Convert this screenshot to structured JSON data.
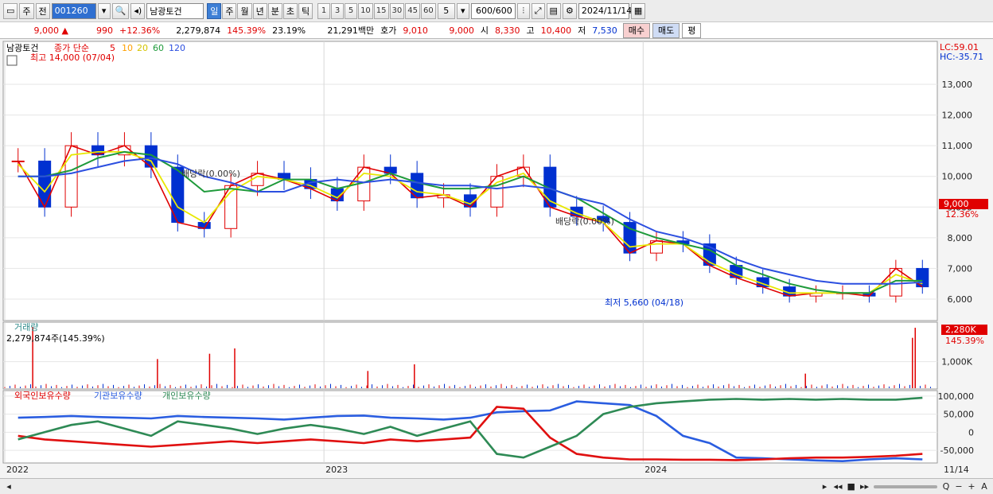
{
  "toolbar": {
    "period_label": "주",
    "nav_label": "전",
    "code": "001260",
    "name": "남광토건",
    "tabs": [
      "일",
      "주",
      "월",
      "년",
      "분",
      "초",
      "틱"
    ],
    "active_tab": "일",
    "intervals": [
      "1",
      "3",
      "5",
      "10",
      "15",
      "30",
      "45",
      "60"
    ],
    "interval_select": "5",
    "range_value": "600",
    "range_total": "/600",
    "date": "2024/11/14"
  },
  "quote": {
    "price": "9,000",
    "price_arrow": "▲",
    "change": "990",
    "change_pct": "+12.36%",
    "volume": "2,279,874",
    "vol_ratio": "145.39%",
    "turnover": "23.19%",
    "amount": "21,291백만",
    "bid_label": "호가",
    "bid": "9,010",
    "ask": "9,000",
    "open_label": "시",
    "open": "8,330",
    "high_label": "고",
    "high": "10,400",
    "low_label": "저",
    "low": "7,530",
    "buy_label": "매수",
    "sell_label": "매도",
    "eval_label": "평"
  },
  "colors": {
    "up": "#e00000",
    "down": "#0030d0",
    "ma5": "#e00000",
    "ma10": "#ffa000",
    "ma20": "#e8e800",
    "ma60": "#1e9a3a",
    "ma120": "#2c4fe0",
    "foreign": "#2a5de0",
    "institution": "#e01010",
    "individual": "#2e8a55"
  },
  "chart_data": [
    {
      "type": "candlestick",
      "legend": {
        "name": "남광토건",
        "label": "종가 단순",
        "periods": [
          "5",
          "10",
          "20",
          "60",
          "120"
        ]
      },
      "x": [
        "2022-01",
        "2022-02",
        "2022-03",
        "2022-04",
        "2022-05",
        "2022-06",
        "2022-07",
        "2022-08",
        "2022-09",
        "2022-10",
        "2022-11",
        "2022-12",
        "2023-01",
        "2023-02",
        "2023-03",
        "2023-04",
        "2023-05",
        "2023-06",
        "2023-07",
        "2023-08",
        "2023-09",
        "2023-10",
        "2023-11",
        "2023-12",
        "2024-01",
        "2024-02",
        "2024-03",
        "2024-04",
        "2024-05",
        "2024-06",
        "2024-07",
        "2024-08",
        "2024-09",
        "2024-10",
        "2024-11"
      ],
      "x_ticks": [
        "2022",
        "2023",
        "2024"
      ],
      "close": [
        10500,
        9000,
        11000,
        10700,
        11000,
        10300,
        8500,
        8300,
        9700,
        10100,
        9900,
        9600,
        9200,
        10300,
        10100,
        9300,
        9400,
        9000,
        10000,
        10300,
        9000,
        8700,
        8500,
        7500,
        7900,
        7800,
        7100,
        6700,
        6400,
        6100,
        6200,
        6200,
        6100,
        7000,
        6400
      ],
      "ma20": [
        10400,
        9500,
        10700,
        10800,
        10800,
        10500,
        9000,
        8500,
        9500,
        10000,
        9900,
        9700,
        9300,
        10100,
        10000,
        9500,
        9400,
        9100,
        9800,
        10100,
        9200,
        8800,
        8500,
        7700,
        7800,
        7800,
        7200,
        6800,
        6500,
        6200,
        6200,
        6200,
        6200,
        6800,
        6500
      ],
      "ma60": [
        10000,
        10000,
        10200,
        10600,
        10800,
        10700,
        10200,
        9500,
        9600,
        9500,
        9900,
        9900,
        9600,
        9800,
        10100,
        9800,
        9600,
        9600,
        9700,
        10000,
        9600,
        9300,
        8800,
        8300,
        8000,
        7800,
        7600,
        7100,
        6800,
        6500,
        6300,
        6200,
        6200,
        6600,
        6600
      ],
      "ma120": [
        10000,
        10000,
        10100,
        10300,
        10500,
        10600,
        10400,
        10000,
        9800,
        9500,
        9500,
        9800,
        9900,
        9800,
        9900,
        9800,
        9700,
        9700,
        9600,
        9700,
        9600,
        9300,
        9100,
        8600,
        8200,
        8000,
        7700,
        7300,
        7000,
        6800,
        6600,
        6500,
        6500,
        6500,
        6550
      ],
      "last_price": "9,000",
      "last_change": "12.36%",
      "y_ticks": [
        "6,000",
        "7,000",
        "8,000",
        "9,000",
        "10,000",
        "11,000",
        "12,000",
        "13,000"
      ],
      "ylim": [
        5300,
        14400
      ],
      "annotations": {
        "lc": "LC:59.01",
        "hc": "HC:-35.71",
        "high": "최고 14,000 (07/04)",
        "low": "최저 5,660 (04/18)",
        "dividend1": "배당락(0.00%)",
        "dividend2": "배당락(0.00%)"
      }
    },
    {
      "type": "bar",
      "title": "거래량",
      "info": "2,279,874주(145.39%)",
      "last": "2,280K",
      "last_pct": "145.39%",
      "y_ticks": [
        "1,000K"
      ],
      "spikes": [
        {
          "x": 0.03,
          "v": 2300
        },
        {
          "x": 0.164,
          "v": 1100
        },
        {
          "x": 0.22,
          "v": 1300
        },
        {
          "x": 0.247,
          "v": 1500
        },
        {
          "x": 0.39,
          "v": 650
        },
        {
          "x": 0.44,
          "v": 900
        },
        {
          "x": 0.86,
          "v": 550
        },
        {
          "x": 0.975,
          "v": 1900
        },
        {
          "x": 0.978,
          "v": 2280
        }
      ]
    },
    {
      "type": "line",
      "series": [
        {
          "name": "외국인보유수량",
          "values": [
            40000,
            42000,
            45000,
            42000,
            40000,
            38000,
            45000,
            42000,
            40000,
            38000,
            35000,
            40000,
            45000,
            46000,
            40000,
            38000,
            35000,
            40000,
            55000,
            58000,
            60000,
            85000,
            80000,
            75000,
            45000,
            -10000,
            -30000,
            -70000,
            -72000,
            -75000,
            -78000,
            -80000,
            -75000,
            -72000,
            -75000
          ]
        },
        {
          "name": "기관보유수량",
          "values": [
            -10000,
            -20000,
            -25000,
            -30000,
            -35000,
            -40000,
            -35000,
            -30000,
            -25000,
            -30000,
            -25000,
            -20000,
            -25000,
            -30000,
            -20000,
            -25000,
            -20000,
            -15000,
            70000,
            65000,
            -15000,
            -60000,
            -70000,
            -75000,
            -75000,
            -76000,
            -76000,
            -77000,
            -75000,
            -72000,
            -70000,
            -70000,
            -68000,
            -65000,
            -60000
          ]
        },
        {
          "name": "개인보유수량",
          "values": [
            -20000,
            0,
            20000,
            30000,
            10000,
            -10000,
            30000,
            20000,
            10000,
            -5000,
            10000,
            20000,
            10000,
            -5000,
            15000,
            -10000,
            10000,
            30000,
            -60000,
            -70000,
            -40000,
            -10000,
            50000,
            70000,
            80000,
            85000,
            90000,
            92000,
            90000,
            92000,
            90000,
            92000,
            90000,
            90000,
            95000
          ]
        }
      ],
      "y_ticks": [
        "100,000",
        "50,000",
        "0",
        "-50,000"
      ],
      "ylim": [
        -85000,
        115000
      ]
    }
  ],
  "x_axis": {
    "labels": [
      "2022",
      "2023",
      "2024"
    ],
    "right_label": "11/14"
  },
  "statusbar": {
    "icons": [
      "◂",
      "▸",
      "◂◂",
      "■",
      "▸▸",
      "Q",
      "−",
      "+",
      "A"
    ]
  }
}
